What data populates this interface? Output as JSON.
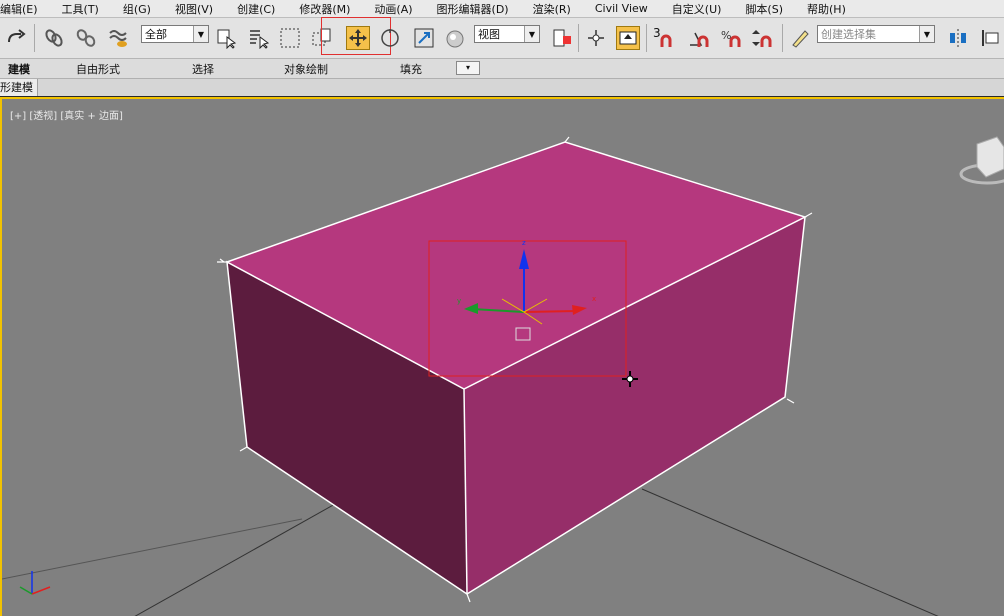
{
  "menu": [
    "编辑(E)",
    "工具(T)",
    "组(G)",
    "视图(V)",
    "创建(C)",
    "修改器(M)",
    "动画(A)",
    "图形编辑器(D)",
    "渲染(R)",
    "Civil View",
    "自定义(U)",
    "脚本(S)",
    "帮助(H)"
  ],
  "toolbar": {
    "selection_filter": "全部",
    "reference_coord": "视图",
    "named_selection_placeholder": "创建选择集",
    "snap_label": "3"
  },
  "ribbon": {
    "tabs": [
      "建模",
      "自由形式",
      "选择",
      "对象绘制",
      "填充"
    ]
  },
  "subbar": {
    "tab": "形建模"
  },
  "viewport": {
    "label": "[+] [透视] [真实 + 边面]",
    "object_color": "#b5387e",
    "active_border_color": "#f2c200",
    "background_color": "#808080"
  },
  "gizmo": {
    "x": "x",
    "y": "y",
    "z": "z"
  }
}
